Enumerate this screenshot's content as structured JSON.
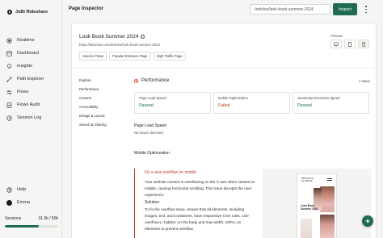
{
  "app": {
    "brand": "JoBi Rideshare"
  },
  "sidebar": {
    "items": [
      {
        "label": "Realtime",
        "icon": "realtime-icon"
      },
      {
        "label": "Dashboard",
        "icon": "dashboard-icon"
      },
      {
        "label": "Insights",
        "icon": "insights-icon"
      },
      {
        "label": "Path Explorer",
        "icon": "path-explorer-icon"
      },
      {
        "label": "Flows",
        "icon": "flows-icon"
      },
      {
        "label": "Flows Audit",
        "icon": "flows-audit-icon"
      },
      {
        "label": "Session Log",
        "icon": "session-log-icon"
      }
    ],
    "help_label": "Help",
    "user_name": "Emma",
    "sessions_label": "Sessions",
    "sessions_value": "31.5k / 50k",
    "sessions_fraction": 0.63
  },
  "header": {
    "title": "Page Inspector",
    "url_value": "/articles/look-book-summer-2024",
    "inspect_label": "Inspect"
  },
  "page": {
    "title": "Look Book Summer 2024",
    "url": "https://lettreast.com/articles/look-book-summer-2024",
    "tags": [
      "Used in Flows",
      "Popular Entrance Page",
      "High Traffic Page"
    ],
    "preview_label": "Preview"
  },
  "toc": [
    "Explore",
    "Performance",
    "Content",
    "Accessibility",
    "Design & Layout",
    "Search & Sharing"
  ],
  "performance": {
    "title": "Performance",
    "issue_count": "1 Issue",
    "metrics": [
      {
        "label": "Page Load Speed",
        "status": "Passed"
      },
      {
        "label": "Mobile Optimization",
        "status": "Failed"
      },
      {
        "label": "JavaScript Execution Speed",
        "status": "Passed"
      }
    ],
    "page_load_title": "Page Load Speed",
    "page_load_sub": "No issues detected.",
    "mobile_title": "Mobile Optimization",
    "issue_title": "Fix x-axis overflow on mobile",
    "issue_text": "Your website content is overflowing on the X-axis when viewed on mobile, causing horizontal scrolling. This issue disrupts the user experience.",
    "solution_title": "Solution",
    "solution_text": "To fix the overflow issue, ensure that all elements, including images, text, and containers, have responsive CSS rules. Use overflow-x: hidden; on the body and max-width: 100%; on elements to prevent overflow."
  },
  "preview": {
    "brand": "BRYNALTE\nLE SENSE",
    "title": "Look Book\nSummer 2024"
  },
  "colors": {
    "accent": "#1e6b52",
    "danger": "#c0392b"
  }
}
